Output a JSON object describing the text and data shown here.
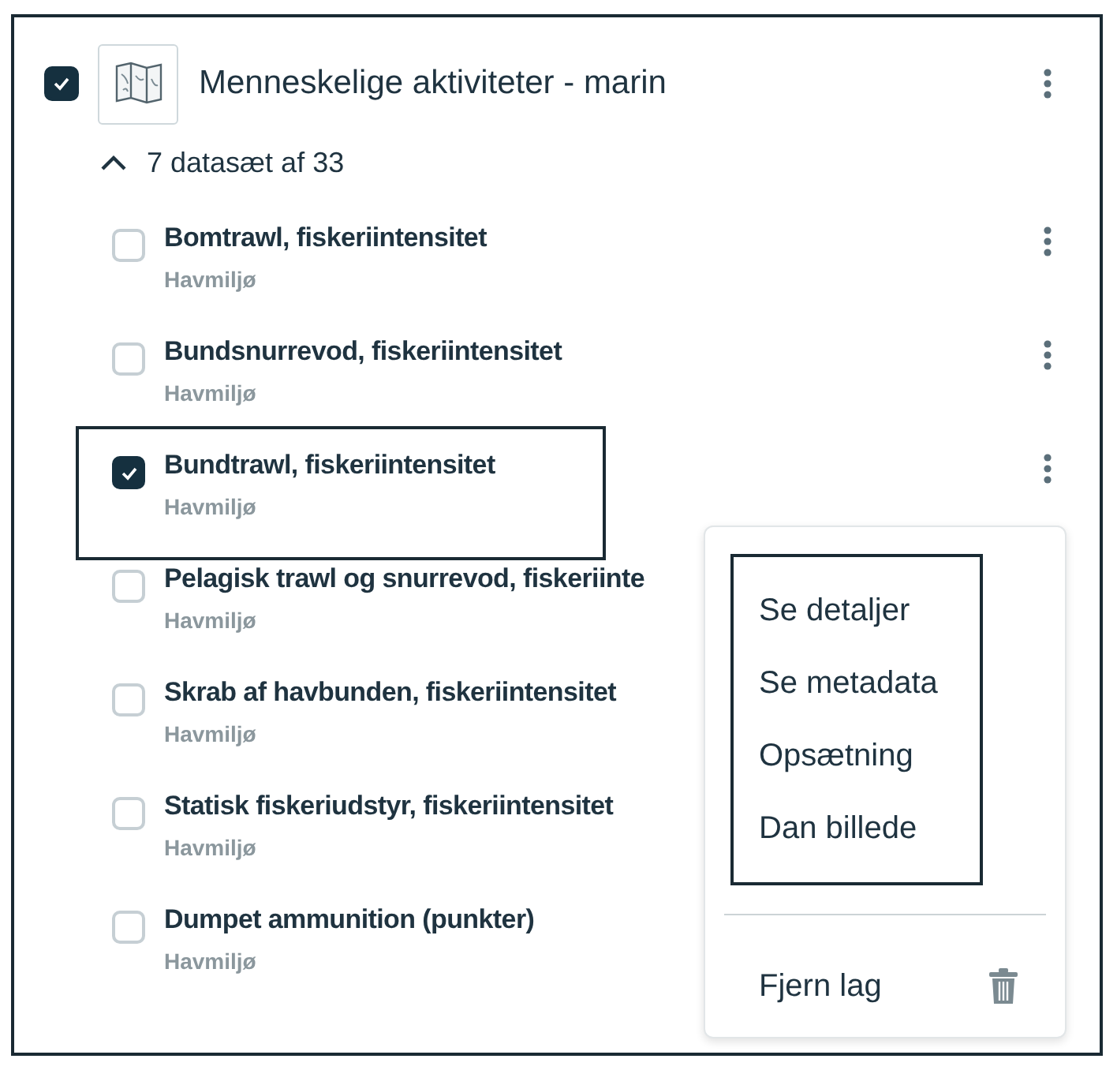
{
  "group": {
    "checked": true,
    "title": "Menneskelige aktiviteter - marin",
    "expanded": true,
    "count_label": "7 datasæt af 33"
  },
  "datasets": [
    {
      "title": "Bomtrawl, fiskeriintensitet",
      "subtitle": "Havmiljø",
      "checked": false,
      "outlined": false,
      "menu_button_visible": true
    },
    {
      "title": "Bundsnurrevod, fiskeriintensitet",
      "subtitle": "Havmiljø",
      "checked": false,
      "outlined": false,
      "menu_button_visible": true
    },
    {
      "title": "Bundtrawl, fiskeriintensitet",
      "subtitle": "Havmiljø",
      "checked": true,
      "outlined": true,
      "menu_button_visible": true
    },
    {
      "title": "Pelagisk trawl og snurrevod, fiskeriinte",
      "subtitle": "Havmiljø",
      "checked": false,
      "outlined": false,
      "menu_button_visible": false
    },
    {
      "title": "Skrab af havbunden, fiskeriintensitet",
      "subtitle": "Havmiljø",
      "checked": false,
      "outlined": false,
      "menu_button_visible": false
    },
    {
      "title": "Statisk fiskeriudstyr, fiskeriintensitet",
      "subtitle": "Havmiljø",
      "checked": false,
      "outlined": false,
      "menu_button_visible": false
    },
    {
      "title": "Dumpet ammunition (punkter)",
      "subtitle": "Havmiljø",
      "checked": false,
      "outlined": false,
      "menu_button_visible": false
    }
  ],
  "context_menu": {
    "items_outlined": true,
    "items": [
      "Se detaljer",
      "Se metadata",
      "Opsætning",
      "Dan billede"
    ],
    "remove_label": "Fjern lag"
  }
}
